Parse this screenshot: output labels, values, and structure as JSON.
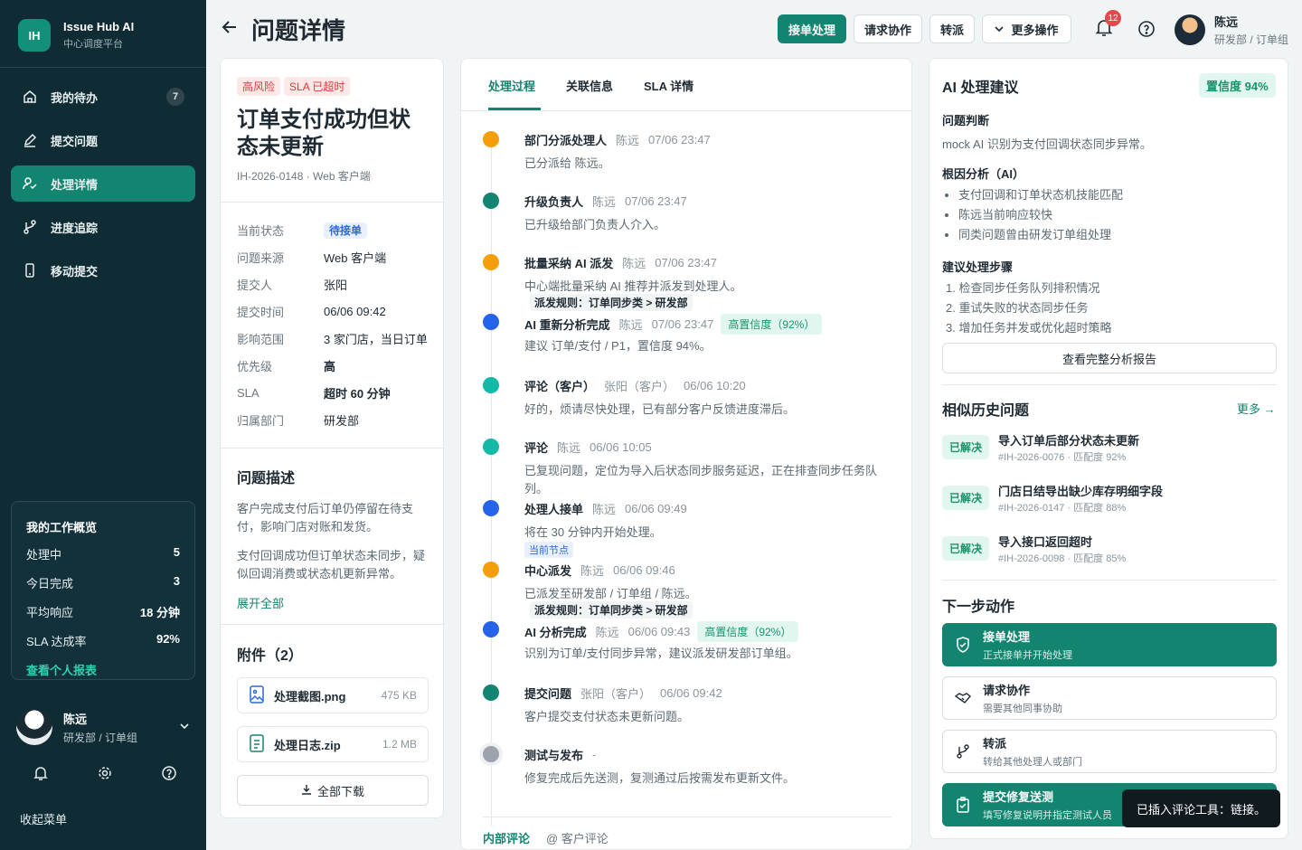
{
  "sidebar": {
    "brand": {
      "logo": "IH",
      "name": "Issue Hub AI",
      "subtitle": "中心调度平台"
    },
    "nav": [
      {
        "label": "我的待办",
        "icon": "home-icon",
        "badge": "7"
      },
      {
        "label": "提交问题",
        "icon": "edit-icon"
      },
      {
        "label": "处理详情",
        "icon": "user-check-icon",
        "active": true
      },
      {
        "label": "进度追踪",
        "icon": "branch-icon"
      },
      {
        "label": "移动提交",
        "icon": "phone-icon"
      }
    ],
    "overview": {
      "title": "我的工作概览",
      "rows": [
        {
          "label": "处理中",
          "value": "5"
        },
        {
          "label": "今日完成",
          "value": "3"
        },
        {
          "label": "平均响应",
          "value": "18 分钟"
        },
        {
          "label": "SLA 达成率",
          "value": "92%"
        }
      ],
      "link": "查看个人报表"
    },
    "user": {
      "name": "陈远",
      "role": "研发部 / 订单组"
    },
    "collapse": "收起菜单"
  },
  "header": {
    "title": "问题详情",
    "buttons": {
      "accept": "接单处理",
      "collab": "请求协作",
      "transfer": "转派",
      "more": "更多操作"
    },
    "notif_count": "12",
    "user": {
      "name": "陈远",
      "role": "研发部 / 订单组"
    }
  },
  "issue": {
    "tags": [
      "高风险",
      "SLA 已超时"
    ],
    "title": "订单支付成功但状态未更新",
    "id_line": "IH-2026-0148 · Web 客户端",
    "fields": {
      "status": {
        "label": "当前状态",
        "value": "待接单"
      },
      "source": {
        "label": "问题来源",
        "value": "Web 客户端"
      },
      "submitter": {
        "label": "提交人",
        "value": "张阳"
      },
      "time": {
        "label": "提交时间",
        "value": "06/06 09:42"
      },
      "scope": {
        "label": "影响范围",
        "value": "3 家门店，当日订单"
      },
      "priority": {
        "label": "优先级",
        "value": "高"
      },
      "sla": {
        "label": "SLA",
        "value": "超时 60 分钟"
      },
      "dept": {
        "label": "归属部门",
        "value": "研发部"
      }
    },
    "desc_title": "问题描述",
    "desc_p1": "客户完成支付后订单仍停留在待支付，影响门店对账和发货。",
    "desc_p2": "支付回调成功但订单状态未同步，疑似回调消费或状态机更新异常。",
    "expand": "展开全部",
    "attach_title": "附件（2）",
    "attachments": [
      {
        "name": "处理截图.png",
        "size": "475 KB"
      },
      {
        "name": "处理日志.zip",
        "size": "1.2 MB"
      }
    ],
    "download_all": "全部下载"
  },
  "tabs": [
    "处理过程",
    "关联信息",
    "SLA 详情"
  ],
  "timeline": [
    {
      "title": "部门分派处理人",
      "person": "陈远",
      "date": "07/06 23:47",
      "body": "已分派给 陈远。",
      "color": "#f59e0b"
    },
    {
      "title": "升级负责人",
      "person": "陈远",
      "date": "07/06 23:47",
      "body": "已升级给部门负责人介入。",
      "color": "#12846f"
    },
    {
      "title": "批量采纳 AI 派发",
      "person": "陈远",
      "date": "07/06 23:47",
      "body": "中心端批量采纳 AI 推荐并派发到处理人。",
      "rule": "派发规则：订单同步类 > 研发部",
      "color": "#f59e0b"
    },
    {
      "title": "AI 重新分析完成",
      "person": "陈远",
      "date": "07/06 23:47",
      "conf": "高置信度（92%）",
      "body": "建议 订单/支付 / P1，置信度 94%。",
      "color": "#2563eb"
    },
    {
      "title": "评论（客户）",
      "person": "张阳（客户）",
      "date": "06/06 10:20",
      "body": "好的，烦请尽快处理，已有部分客户反馈进度滞后。",
      "color": "#14b8a6"
    },
    {
      "title": "评论",
      "person": "陈远",
      "date": "06/06 10:05",
      "body": "已复现问题，定位为导入后状态同步服务延迟，正在排查同步任务队列。",
      "color": "#14b8a6"
    },
    {
      "title": "处理人接单",
      "person": "陈远",
      "date": "06/06 09:49",
      "body": "将在 30 分钟内开始处理。",
      "current": "当前节点",
      "color": "#2563eb"
    },
    {
      "title": "中心派发",
      "person": "陈远",
      "date": "06/06 09:46",
      "body": "已派发至研发部 / 订单组 / 陈远。",
      "rule": "派发规则：订单同步类 > 研发部",
      "color": "#f59e0b"
    },
    {
      "title": "AI 分析完成",
      "person": "陈远",
      "date": "06/06 09:43",
      "conf": "高置信度（92%）",
      "body": "识别为订单/支付同步异常，建议派发研发部订单组。",
      "color": "#2563eb"
    },
    {
      "title": "提交问题",
      "person": "张阳（客户）",
      "date": "06/06 09:42",
      "body": "客户提交支付状态未更新问题。",
      "color": "#12846f"
    },
    {
      "title": "测试与发布",
      "person": "-",
      "date": "",
      "body": "修复完成后先送测，复测通过后按需发布更新文件。",
      "color": "#9ca3af"
    }
  ],
  "comment_tabs": {
    "internal": "内部评论",
    "customer": "@ 客户评论"
  },
  "ai": {
    "title": "AI 处理建议",
    "confidence": "置信度 94%",
    "judge_title": "问题判断",
    "judge_text": "mock AI 识别为支付回调状态同步异常。",
    "cause_title": "根因分析（AI）",
    "causes": [
      "支付回调和订单状态机技能匹配",
      "陈远当前响应较快",
      "同类问题曾由研发订单组处理"
    ],
    "steps_title": "建议处理步骤",
    "steps": [
      "1. 检查同步任务队列排积情况",
      "2. 重试失败的状态同步任务",
      "3. 增加任务并发或优化超时策略"
    ],
    "report_btn": "查看完整分析报告"
  },
  "similar": {
    "title": "相似历史问题",
    "more": "更多",
    "items": [
      {
        "status": "已解决",
        "title": "导入订单后部分状态未更新",
        "meta": "#IH-2026-0076 · 匹配度 92%"
      },
      {
        "status": "已解决",
        "title": "门店日结导出缺少库存明细字段",
        "meta": "#IH-2026-0147 · 匹配度 88%"
      },
      {
        "status": "已解决",
        "title": "导入接口返回超时",
        "meta": "#IH-2026-0098 · 匹配度 85%"
      }
    ]
  },
  "next": {
    "title": "下一步动作",
    "actions": [
      {
        "name": "接单处理",
        "desc": "正式接单并开始处理"
      },
      {
        "name": "请求协作",
        "desc": "需要其他同事协助"
      },
      {
        "name": "转派",
        "desc": "转给其他处理人或部门"
      },
      {
        "name": "提交修复送测",
        "desc": "填写修复说明并指定测试人员"
      }
    ]
  },
  "toast": "已插入评论工具：链接。"
}
